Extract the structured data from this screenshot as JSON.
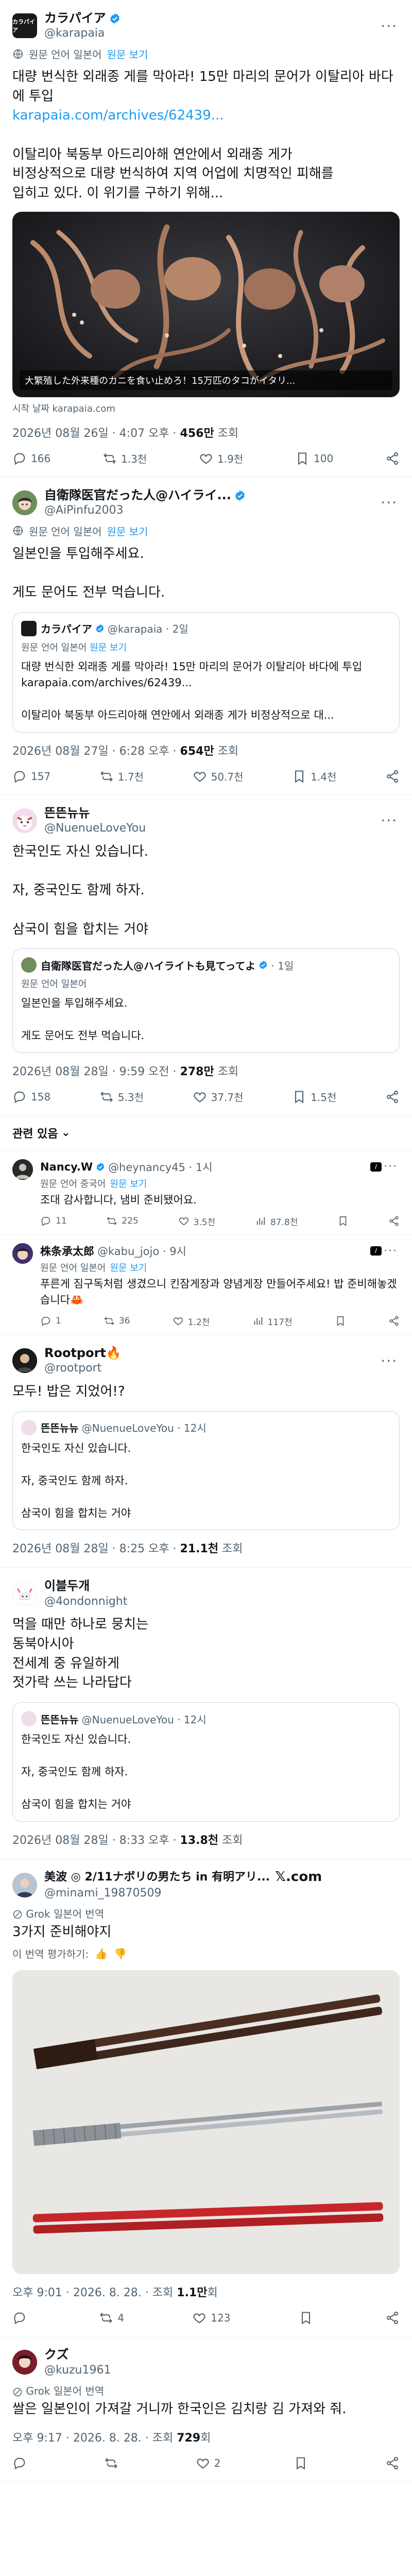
{
  "post1": {
    "display_name": "カラパイア",
    "handle": "@karapaia",
    "avatar_text": "カラパイア",
    "translate_label": "원문 언어 일본어",
    "view_original": "원문 보기",
    "body": "대량 번식한 외래종 게를 막아라! 15만 마리의 문어가 이탈리아 바다에 투입",
    "url": "karapaia.com/archives/62439...",
    "body2": "이탈리아 북동부 아드리아해 연안에서 외래종 게가\n비정상적으로 대량 번식하여 지역 어업에 치명적인 피해를\n입히고 있다. 이 위기를 구하기 위해...",
    "card_caption": "大繁殖した外来種のカニを食い止めろ！15万匹のタコがイタリ...",
    "card_source": "시작 날짜 karapaia.com",
    "time": "2026년 08월 26일 · 4:07 오후 · ",
    "views": "456만",
    "views_suffix": " 조회",
    "replies": "166",
    "reposts": "1.3천",
    "likes": "1.9천",
    "bookmarks": "100"
  },
  "post2": {
    "display_name": "自衛隊医官だった人@ハイライ...",
    "handle": "@AiPinfu2003",
    "translate_label": "원문 언어 일본어",
    "view_original": "원문 보기",
    "body": "일본인을 투입해주세요.\n\n게도 문어도 전부 먹습니다.",
    "quote_name": "カラパイア",
    "quote_handle": "@karapaia · 2일",
    "quote_translate": "원문 언어 일본어",
    "quote_view": "원문 보기",
    "quote_body": "대량 번식한 외래종 게를 막아라! 15만 마리의 문어가 이탈리아 바다에 투입\nkarapaia.com/archives/62439...\n\n이탈리아 북동부 아드리아해 연안에서 외래종 게가 비정상적으로 대...",
    "time": "2026년 08월 27일 · 6:28 오후 · ",
    "views": "654만",
    "views_suffix": " 조회",
    "replies": "157",
    "reposts": "1.7천",
    "likes": "50.7천",
    "bookmarks": "1.4천"
  },
  "post3": {
    "display_name": "뜬뜬뉴뉴",
    "handle": "@NuenueLoveYou",
    "body": "한국인도 자신 있습니다.\n\n자, 중국인도 함께 하자.\n\n삼국이 힘을 합치는 거야",
    "quote_name": "自衛隊医官だった人@ハイライトも見てってよ",
    "quote_handle": "· 1일",
    "quote_translate": "원문 언어 일본어",
    "quote_body": "일본인을 투입해주세요.\n\n게도 문어도 전부 먹습니다.",
    "time": "2026년 08월 28일 · 9:59 오전 · ",
    "views": "278만",
    "views_suffix": " 조회",
    "replies": "158",
    "reposts": "5.3천",
    "likes": "37.7천",
    "bookmarks": "1.5천"
  },
  "related": {
    "title": "관련 있음",
    "chevron": "⌄"
  },
  "reply1": {
    "display_name": "Nancy.W",
    "handle": "@heynancy45 · 1시",
    "trans": "원문 언어 중국어",
    "view": "원문 보기",
    "body": "조대 감사합니다, 냄비 준비됐어요.",
    "replies": "11",
    "reposts": "225",
    "likes": "3.5천",
    "views": "87.8천"
  },
  "reply2": {
    "display_name": "株条承太郎",
    "handle": "@kabu_jojo · 9시",
    "trans": "원문 언어 일본어",
    "view": "원문 보기",
    "body": "푸른게 짐구독처럼 생겼으니 킨잠게장과 양념게장 만들어주세요! 밥 준비해놓겠습니다🦀",
    "replies": "1",
    "reposts": "36",
    "likes": "1.2천",
    "views": "117천"
  },
  "post4": {
    "display_name": "Rootport🔥",
    "handle": "@rootport",
    "body": "모두! 밥은 지었어!?",
    "quote_name": "뜬뜬뉴뉴",
    "quote_handle": "@NuenueLoveYou · 12시",
    "quote_body": "한국인도 자신 있습니다.\n\n자, 중국인도 함께 하자.\n\n삼국이 힘을 합치는 거야",
    "time": "2026년 08월 28일 · 8:25 오후 · ",
    "views": "21.1천",
    "views_suffix": " 조회"
  },
  "post5": {
    "display_name": "이블두개",
    "handle": "@4ondonnight",
    "body": "먹을 때만 하나로 뭉치는\n동북아시아\n전세계 중 유일하게\n젓가락 쓰는 나라답다",
    "quote_name": "뜬뜬뉴뉴",
    "quote_handle": "@NuenueLoveYou · 12시",
    "quote_body": "한국인도 자신 있습니다.\n\n자, 중국인도 함께 하자.\n\n삼국이 힘을 합치는 거야",
    "time": "2026년 08월 28일 · 8:33 오후 · ",
    "views": "13.8천",
    "views_suffix": " 조회"
  },
  "post6": {
    "display_name": "美波 ◎ 2/11ナボリの男たち in 有明アリ...",
    "x_label": "𝕏.com",
    "handle": "@minami_19870509",
    "grok_note": "Grok 일본어 번역",
    "body": "3가지 준비해야지",
    "rate_label": "이 번역 평가하기:",
    "time": "오후 9:01 · 2026. 8. 28. · 조회 ",
    "views": "1.1만",
    "views_suffix": "회",
    "replies": "",
    "reposts": "4",
    "likes": "123",
    "bookmarks": ""
  },
  "post7": {
    "display_name": "クズ",
    "handle": "@kuzu1961",
    "grok_note": "Grok 일본어 번역",
    "body": "쌀은 일본인이 가져갈 거니까 한국인은 김치랑 김 가져와 줘.",
    "time": "오후 9:17 · 2026. 8. 28. · 조회 ",
    "views": "729",
    "views_suffix": "회",
    "replies": "",
    "reposts": "",
    "likes": "2",
    "bookmarks": ""
  },
  "colors": {
    "accent": "#1d9bf0",
    "text": "#0f1419",
    "muted": "#536471",
    "border": "#cfd9de"
  }
}
